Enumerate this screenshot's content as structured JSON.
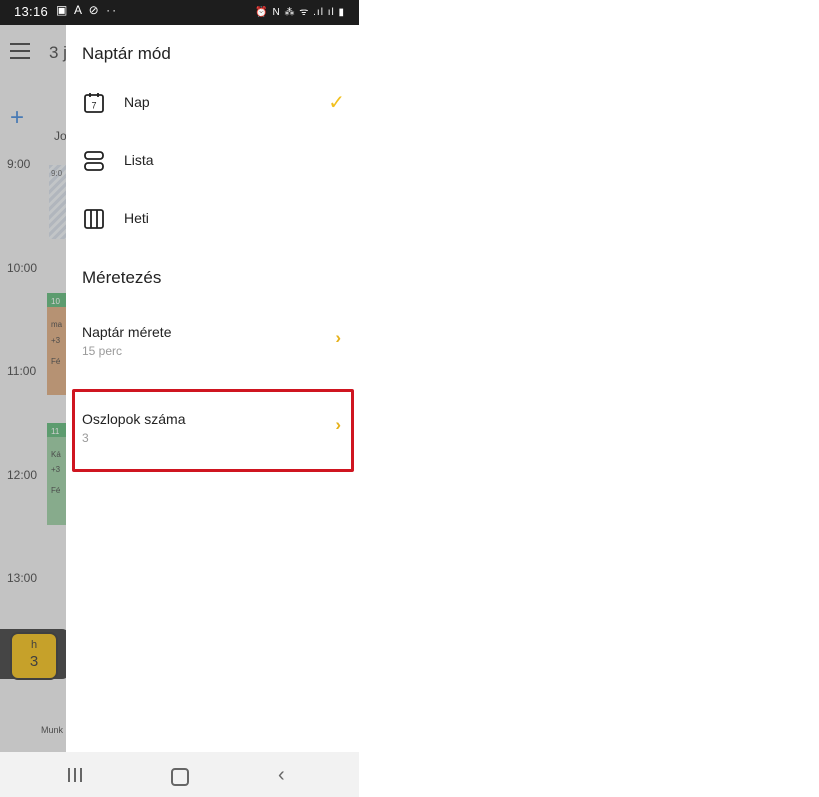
{
  "status_bar": {
    "time": "13:16",
    "left_icons": "▣ A ⊘ ··",
    "right_icons": "⏰ N ⁂ ᯤ .ıl ıl ▮"
  },
  "background_app": {
    "date_partial": "3 j",
    "column_header": "Jo",
    "hours": [
      "9:00",
      "10:00",
      "11:00",
      "12:00",
      "13:00"
    ],
    "hatched_label": "9:0",
    "event1": {
      "t1": "10",
      "t2": "ma",
      "t3": "+3",
      "t4": "Fé"
    },
    "event2": {
      "t1": "11",
      "t2": "Ká",
      "t3": "+3",
      "t4": "Fé"
    },
    "day_chip": {
      "day_name": "h",
      "day_num": "3"
    },
    "bottom_label": "Munk"
  },
  "drawer": {
    "calendar_mode_title": "Naptár mód",
    "modes": [
      {
        "label": "Nap",
        "icon": "calendar-day-icon",
        "icon_text": "7",
        "selected": true
      },
      {
        "label": "Lista",
        "icon": "list-icon",
        "selected": false
      },
      {
        "label": "Heti",
        "icon": "week-columns-icon",
        "selected": false
      }
    ],
    "sizing_title": "Méretezés",
    "settings": [
      {
        "title": "Naptár mérete",
        "value": "15 perc"
      },
      {
        "title": "Oszlopok száma",
        "value": "3"
      }
    ]
  },
  "colors": {
    "accent": "#f2c01e",
    "highlight": "#cf1520",
    "muted_text": "#9a9a9a"
  }
}
